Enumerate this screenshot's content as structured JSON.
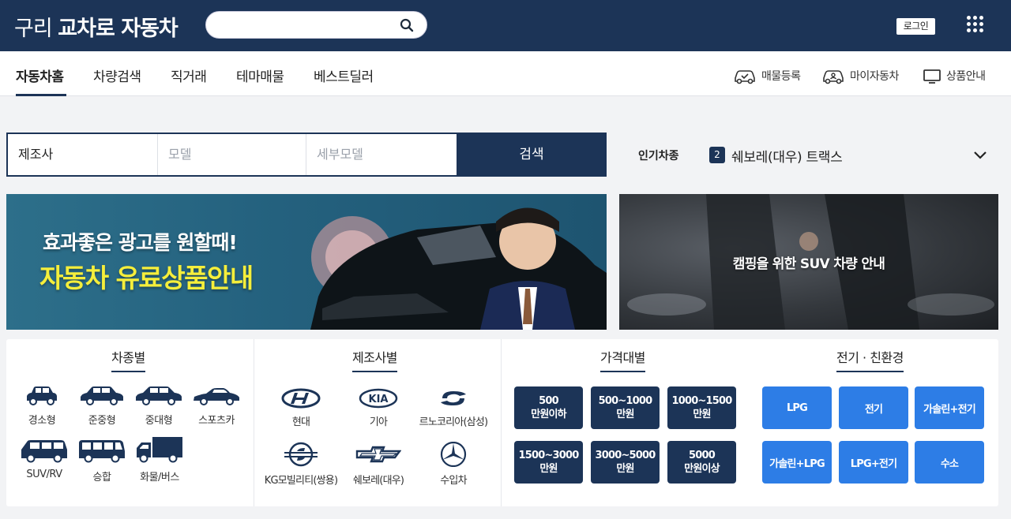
{
  "header": {
    "logo_light": "구리",
    "logo_bold": "교차로 자동차",
    "search_placeholder": "",
    "login_label": "로그인"
  },
  "nav": {
    "tabs": [
      {
        "label": "자동차홈",
        "active": true
      },
      {
        "label": "차량검색"
      },
      {
        "label": "직거래"
      },
      {
        "label": "테마매물"
      },
      {
        "label": "베스트딜러"
      }
    ],
    "right_links": [
      {
        "label": "매물등록",
        "icon": "car-register-icon"
      },
      {
        "label": "마이자동차",
        "icon": "my-car-icon"
      },
      {
        "label": "상품안내",
        "icon": "monitor-icon"
      }
    ]
  },
  "finder": {
    "maker": "제조사",
    "model_placeholder": "모델",
    "detail_placeholder": "세부모델",
    "search_label": "검색"
  },
  "popular": {
    "label": "인기차종",
    "rank": "2",
    "car": "쉐보레(대우) 트랙스"
  },
  "banners": {
    "ad_line1": "효과좋은 광고를 원할때!",
    "ad_line2": "자동차 유료상품안내",
    "camping": "캠핑을 위한 SUV 차량 안내"
  },
  "by_type": {
    "title": "차종별",
    "items": [
      "경소형",
      "준중형",
      "중대형",
      "스포츠카",
      "SUV/RV",
      "승합",
      "화물/버스"
    ]
  },
  "by_maker": {
    "title": "제조사별",
    "items": [
      "현대",
      "기아",
      "르노코리아(삼성)",
      "KG모빌리티(쌍용)",
      "쉐보레(대우)",
      "수입차"
    ]
  },
  "by_price": {
    "title": "가격대별",
    "items": [
      "500\n만원이하",
      "500~1000\n만원",
      "1000~1500\n만원",
      "1500~3000\n만원",
      "3000~5000\n만원",
      "5000\n만원이상"
    ]
  },
  "by_eco": {
    "title": "전기 · 친환경",
    "items": [
      "LPG",
      "전기",
      "가솔린+전기",
      "가솔린+LPG",
      "LPG+전기",
      "수소"
    ]
  },
  "colors": {
    "navy": "#1c3457",
    "blue_button": "#2d7de6",
    "ad_yellow": "#f5ee3b"
  }
}
